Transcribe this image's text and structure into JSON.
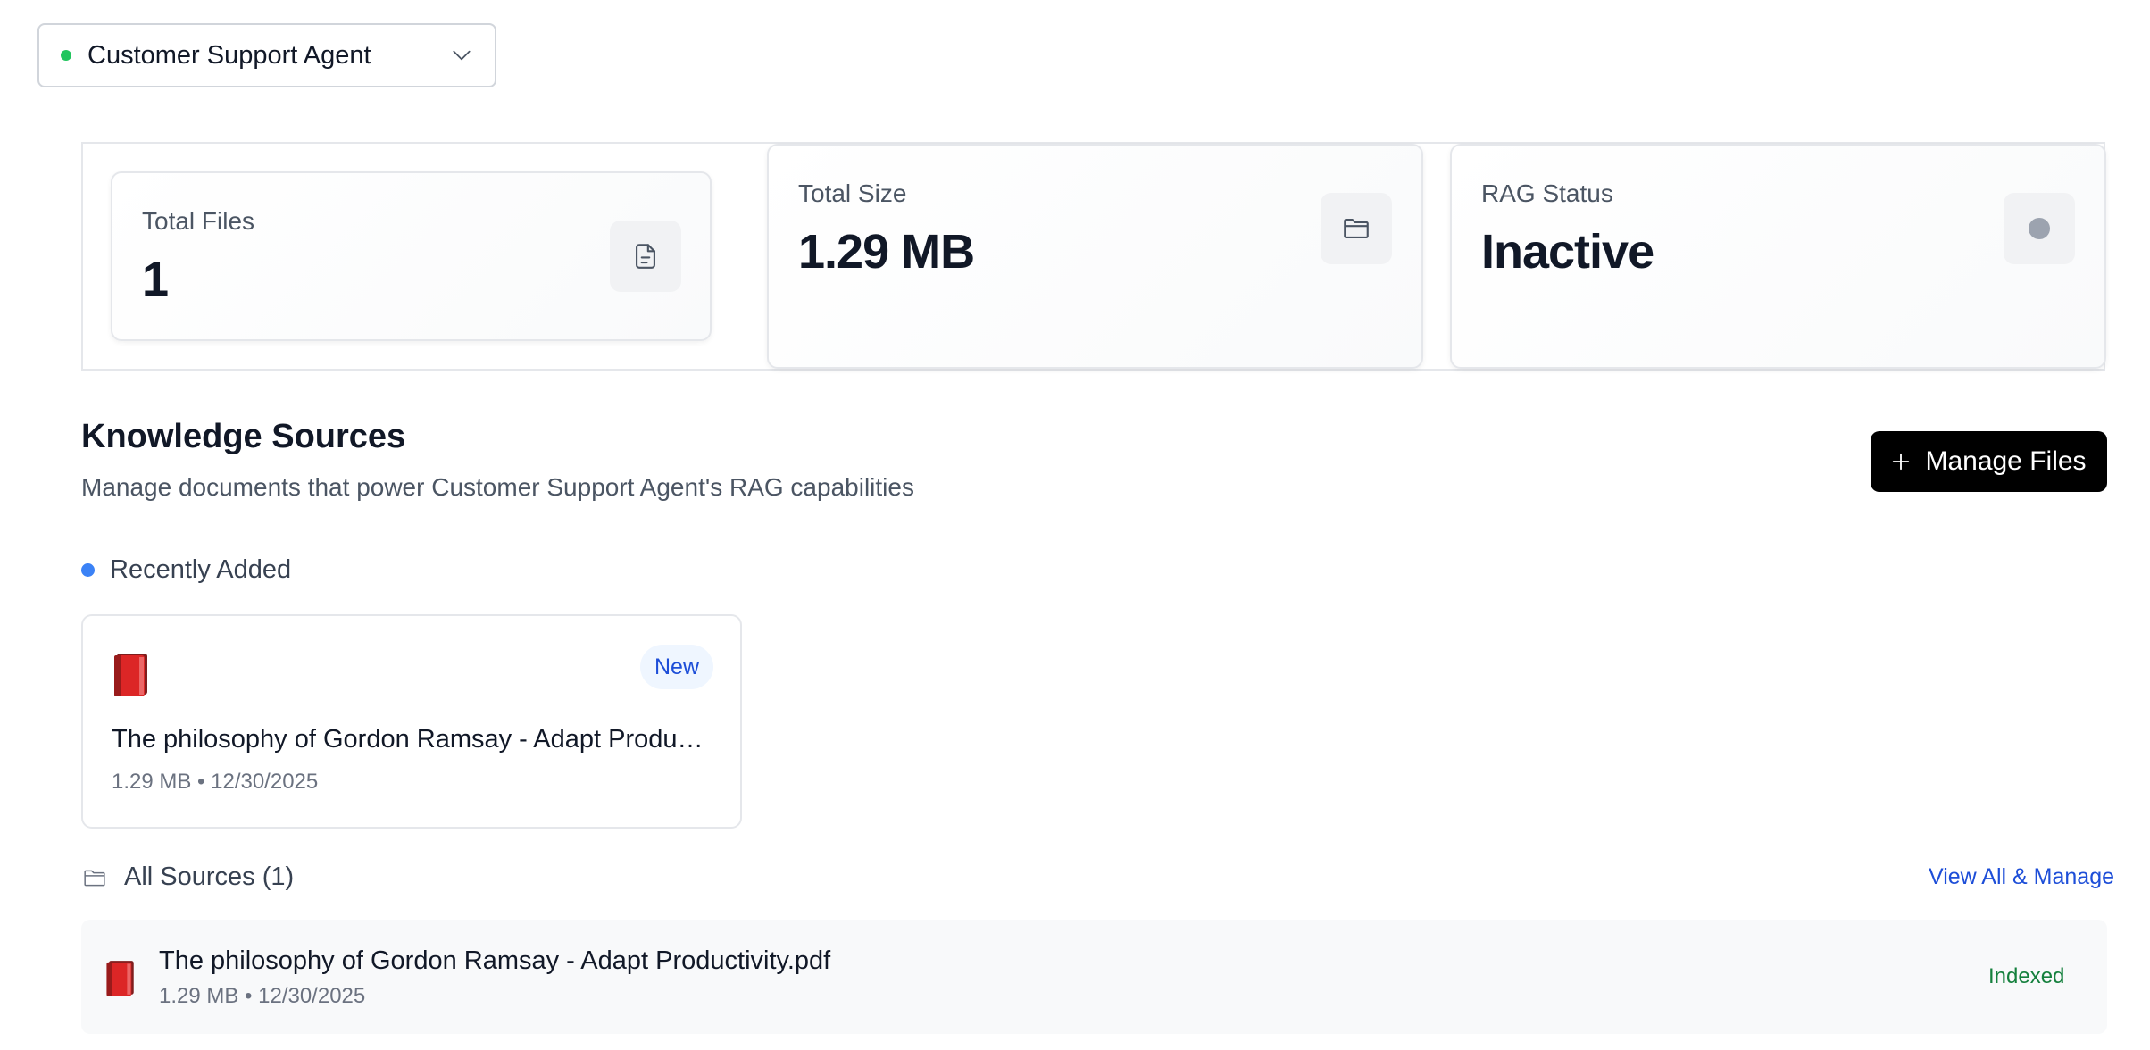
{
  "agent_selector": {
    "name": "Customer Support Agent",
    "status_color": "#22c55e",
    "icon": "chevron-down-icon"
  },
  "stats": {
    "total_files": {
      "label": "Total Files",
      "value": "1",
      "icon": "file-text-icon"
    },
    "total_size": {
      "label": "Total Size",
      "value": "1.29 MB",
      "icon": "folder-icon"
    },
    "rag_status": {
      "label": "RAG Status",
      "value": "Inactive",
      "icon": "status-dot-icon"
    }
  },
  "knowledge": {
    "title": "Knowledge Sources",
    "subtitle": "Manage documents that power Customer Support Agent's RAG capabilities",
    "manage_button": "Manage Files"
  },
  "recent": {
    "heading": "Recently Added",
    "items": [
      {
        "name": "The philosophy of Gordon Ramsay - Adapt Productivity.pdf",
        "meta": "1.29 MB • 12/30/2025",
        "badge": "New",
        "icon": "book-icon"
      }
    ]
  },
  "all_sources": {
    "heading": "All Sources (1)",
    "view_all": "View All & Manage",
    "items": [
      {
        "name": "The philosophy of Gordon Ramsay - Adapt Productivity.pdf",
        "meta": "1.29 MB • 12/30/2025",
        "status": "Indexed",
        "icon": "book-icon"
      }
    ]
  },
  "colors": {
    "accent": "#3b82f6",
    "link": "#1d4ed8",
    "success": "#15803d",
    "button_bg": "#000000"
  }
}
